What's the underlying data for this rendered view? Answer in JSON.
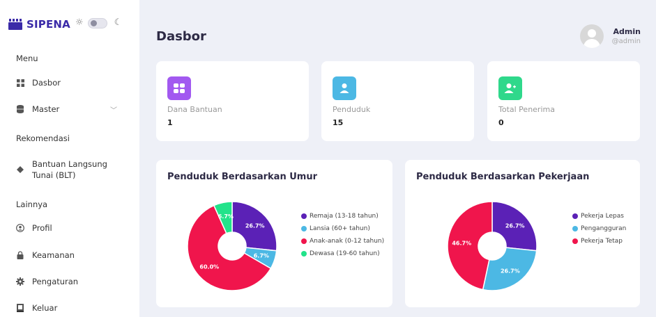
{
  "app": {
    "brand": "SIPENA"
  },
  "colors": {
    "purple": "#5b21b6",
    "cyan": "#4cb8e4",
    "crimson": "#f0154c",
    "mint": "#22e38a",
    "statPurple": "#a259f0",
    "statCyan": "#4cb8e4",
    "statGreen": "#2fd88b"
  },
  "sidebar": {
    "sections": {
      "menu": "Menu",
      "rekomendasi": "Rekomendasi",
      "lainnya": "Lainnya"
    },
    "items": {
      "dasbor": "Dasbor",
      "master": "Master",
      "blt_line1": "Bantuan Langsung",
      "blt_line2": "Tunai (BLT)",
      "profil": "Profil",
      "keamanan": "Keamanan",
      "pengaturan": "Pengaturan",
      "keluar": "Keluar"
    }
  },
  "header": {
    "title": "Dasbor",
    "user_name": "Admin",
    "user_handle": "@admin"
  },
  "stats": [
    {
      "label": "Dana Bantuan",
      "value": "1",
      "icon": "grid-icon"
    },
    {
      "label": "Penduduk",
      "value": "15",
      "icon": "user-icon"
    },
    {
      "label": "Total Penerima",
      "value": "0",
      "icon": "user-plus-icon"
    }
  ],
  "chart_data": [
    {
      "type": "pie",
      "title": "Penduduk Berdasarkan Umur",
      "categories": [
        "Remaja (13-18 tahun)",
        "Lansia (60+ tahun)",
        "Anak-anak (0-12 tahun)",
        "Dewasa (19-60 tahun)"
      ],
      "values": [
        26.7,
        6.7,
        60.0,
        6.7
      ],
      "labels": [
        "26.7%",
        "6.7%",
        "60.0%",
        "6.7%"
      ],
      "colors": [
        "#5b21b6",
        "#4cb8e4",
        "#f0154c",
        "#22e38a"
      ],
      "legend": "right"
    },
    {
      "type": "pie",
      "title": "Penduduk Berdasarkan Pekerjaan",
      "categories": [
        "Pekerja Lepas",
        "Pengangguran",
        "Pekerja Tetap"
      ],
      "values": [
        26.7,
        26.7,
        46.7
      ],
      "labels": [
        "26.7%",
        "26.7%",
        "46.7%"
      ],
      "colors": [
        "#5b21b6",
        "#4cb8e4",
        "#f0154c"
      ],
      "legend": "right"
    }
  ]
}
